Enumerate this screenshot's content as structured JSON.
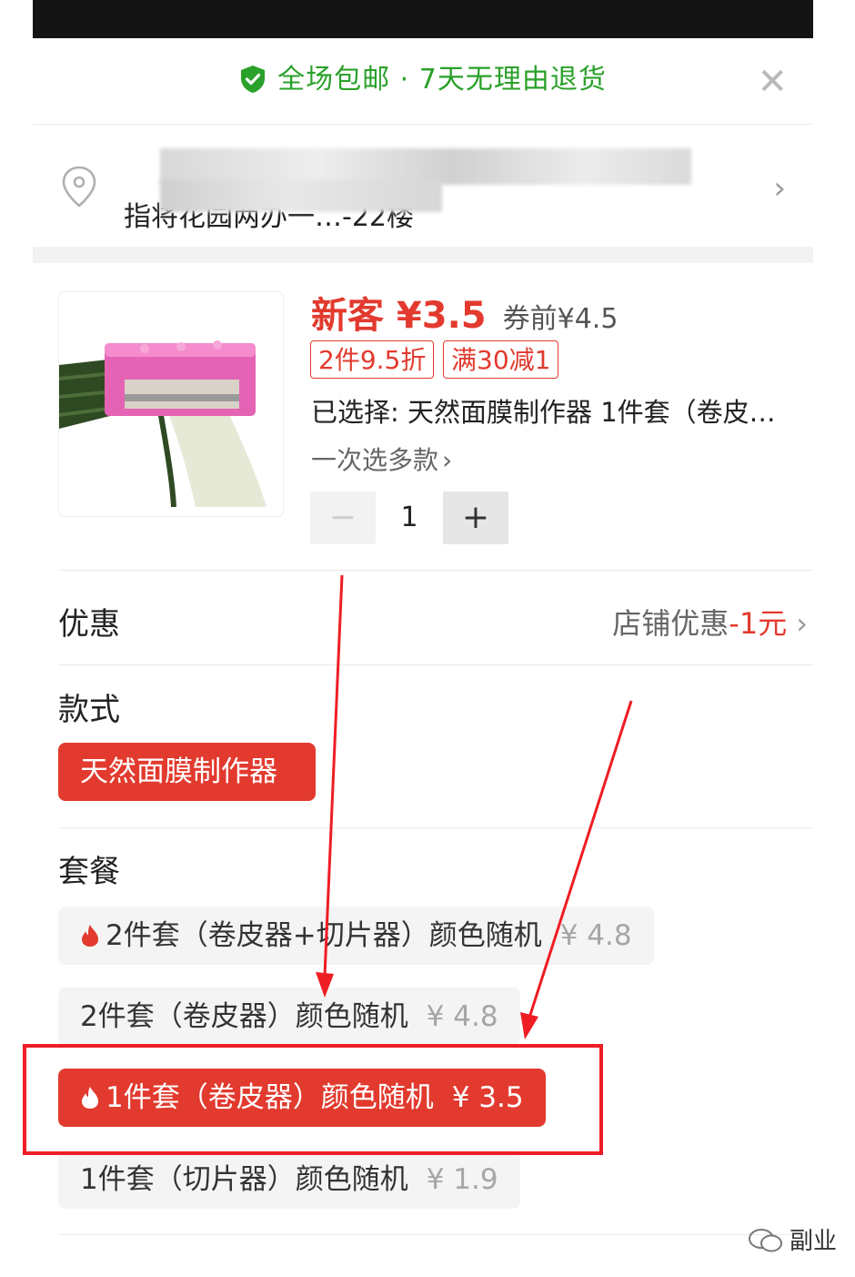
{
  "banner": {
    "text": "全场包邮 · 7天无理由退货",
    "close_icon": "close-icon",
    "accent": "#2aa12a"
  },
  "address": {
    "line1_end": "区",
    "line2": "指将花园两办一…-22楼"
  },
  "product": {
    "new_price": "新客 ¥3.5",
    "before_price": "券前¥4.5",
    "tags": [
      "2件9.5折",
      "满30减1"
    ],
    "selected": "已选择: 天然面膜制作器 1件套（卷皮…",
    "multi_select": "一次选多款",
    "quantity": "1",
    "minus": "−",
    "plus": "+"
  },
  "promo": {
    "label": "优惠",
    "value_text": "店铺优惠",
    "value_amount": "-1元"
  },
  "style_section": {
    "label": "款式",
    "options": [
      "天然面膜制作器"
    ]
  },
  "package_section": {
    "label": "套餐",
    "options": [
      {
        "label": "2件套（卷皮器+切片器）颜色随机",
        "price": "¥ 4.8",
        "hot": true,
        "selected": false
      },
      {
        "label": "2件套（卷皮器）颜色随机",
        "price": "¥ 4.8",
        "hot": false,
        "selected": false
      },
      {
        "label": "1件套（卷皮器）颜色随机",
        "price": "¥ 3.5",
        "hot": true,
        "selected": true
      },
      {
        "label": "1件套（切片器）颜色随机",
        "price": "¥ 1.9",
        "hot": false,
        "selected": false
      }
    ]
  },
  "watermark": {
    "text": "副业"
  },
  "colors": {
    "primary_red": "#e23a2e",
    "annotation_red": "#ef1d24"
  }
}
